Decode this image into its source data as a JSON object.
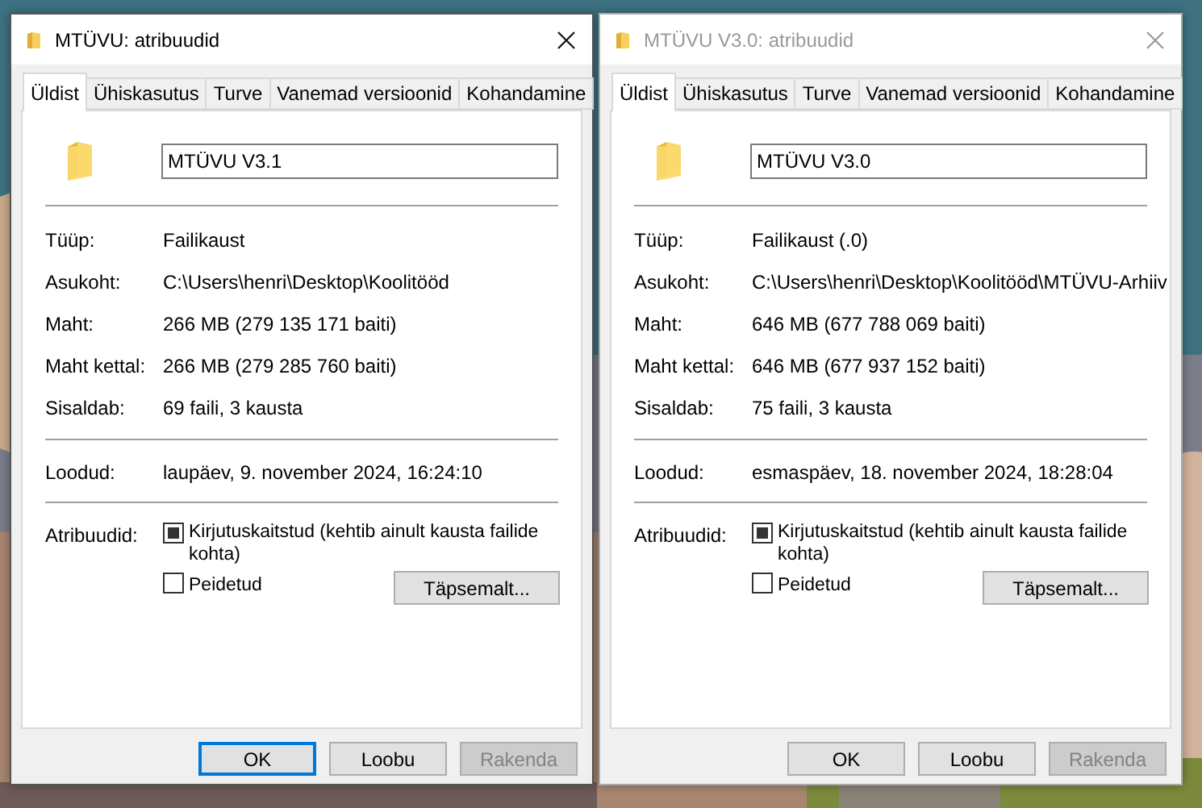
{
  "dialogs": [
    {
      "title": "MTÜVU: atribuudid",
      "active": true,
      "tabs": [
        {
          "label": "Üldist",
          "selected": true
        },
        {
          "label": "Ühiskasutus",
          "selected": false
        },
        {
          "label": "Turve",
          "selected": false
        },
        {
          "label": "Vanemad versioonid",
          "selected": false
        },
        {
          "label": "Kohandamine",
          "selected": false
        }
      ],
      "name": "MTÜVU V3.1",
      "details": [
        {
          "label": "Tüüp:",
          "value": "Failikaust"
        },
        {
          "label": "Asukoht:",
          "value": "C:\\Users\\henri\\Desktop\\Koolitööd"
        },
        {
          "label": "Maht:",
          "value": "266 MB (279 135 171 baiti)"
        },
        {
          "label": "Maht kettal:",
          "value": "266 MB (279 285 760 baiti)"
        },
        {
          "label": "Sisaldab:",
          "value": "69 faili, 3 kausta"
        }
      ],
      "created": {
        "label": "Loodud:",
        "value": "laupäev, 9. november 2024, 16:24:10"
      },
      "attributes_label": "Atribuudid:",
      "attributes": [
        {
          "label": "Kirjutuskaitstud (kehtib ainult kausta failide kohta)",
          "checked": true
        },
        {
          "label": "Peidetud",
          "checked": false
        }
      ],
      "advanced_button": "Täpsemalt...",
      "buttons": [
        {
          "label": "OK",
          "focused": true,
          "disabled": false
        },
        {
          "label": "Loobu",
          "focused": false,
          "disabled": false
        },
        {
          "label": "Rakenda",
          "focused": false,
          "disabled": true
        }
      ]
    },
    {
      "title": "MTÜVU V3.0: atribuudid",
      "active": false,
      "tabs": [
        {
          "label": "Üldist",
          "selected": true
        },
        {
          "label": "Ühiskasutus",
          "selected": false
        },
        {
          "label": "Turve",
          "selected": false
        },
        {
          "label": "Vanemad versioonid",
          "selected": false
        },
        {
          "label": "Kohandamine",
          "selected": false
        }
      ],
      "name": "MTÜVU V3.0",
      "details": [
        {
          "label": "Tüüp:",
          "value": "Failikaust (.0)"
        },
        {
          "label": "Asukoht:",
          "value": "C:\\Users\\henri\\Desktop\\Koolitööd\\MTÜVU-Arhiiv"
        },
        {
          "label": "Maht:",
          "value": "646 MB (677 788 069 baiti)"
        },
        {
          "label": "Maht kettal:",
          "value": "646 MB (677 937 152 baiti)"
        },
        {
          "label": "Sisaldab:",
          "value": "75 faili, 3 kausta"
        }
      ],
      "created": {
        "label": "Loodud:",
        "value": "esmaspäev, 18. november 2024, 18:28:04"
      },
      "attributes_label": "Atribuudid:",
      "attributes": [
        {
          "label": "Kirjutuskaitstud (kehtib ainult kausta failide kohta)",
          "checked": true
        },
        {
          "label": "Peidetud",
          "checked": false
        }
      ],
      "advanced_button": "Täpsemalt...",
      "buttons": [
        {
          "label": "OK",
          "focused": false,
          "disabled": false
        },
        {
          "label": "Loobu",
          "focused": false,
          "disabled": false
        },
        {
          "label": "Rakenda",
          "focused": false,
          "disabled": true
        }
      ]
    }
  ]
}
